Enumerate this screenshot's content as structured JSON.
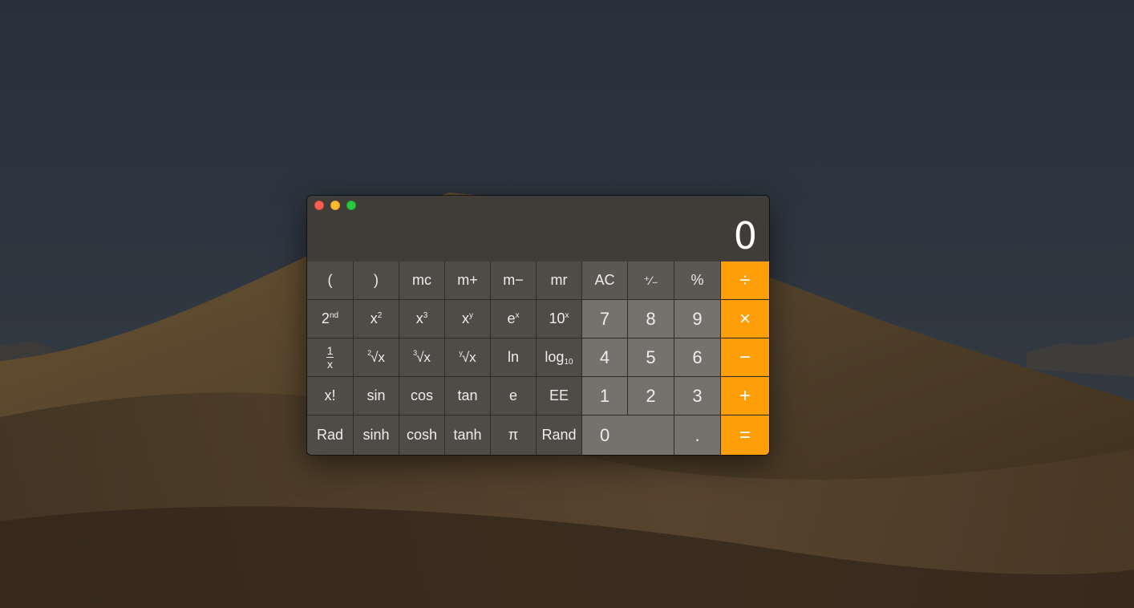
{
  "window": {
    "display_value": "0"
  },
  "colors": {
    "operator": "#fe9f0a",
    "number_key": "#75716d",
    "function_key": "#5b5753",
    "scientific_key": "#4f4b47",
    "close": "#fe5f57",
    "minimize": "#febc2e",
    "maximize": "#28c840"
  },
  "keys": {
    "open_paren": "(",
    "close_paren": ")",
    "mc": "mc",
    "m_plus": "m+",
    "m_minus": "m−",
    "mr": "mr",
    "ac": "AC",
    "plus_minus": "⁺∕₋",
    "percent": "%",
    "divide": "÷",
    "second_base": "2",
    "second_sup": "nd",
    "x_base": "x",
    "sq_sup": "2",
    "cube_sup": "3",
    "pow_sup": "y",
    "e_base": "e",
    "ex_sup": "x",
    "ten_base": "10",
    "tenx_sup": "x",
    "seven": "7",
    "eight": "8",
    "nine": "9",
    "multiply": "×",
    "recip_top": "1",
    "recip_bottom": "x",
    "sqrt_index": "2",
    "cbrt_index": "3",
    "yroot_index": "y",
    "root_x": "√x",
    "ln": "ln",
    "log_base": "log",
    "log_sub": "10",
    "four": "4",
    "five": "5",
    "six": "6",
    "minus": "−",
    "factorial": "x!",
    "sin": "sin",
    "cos": "cos",
    "tan": "tan",
    "e": "e",
    "ee": "EE",
    "one": "1",
    "two": "2",
    "three": "3",
    "plus": "+",
    "rad": "Rad",
    "sinh": "sinh",
    "cosh": "cosh",
    "tanh": "tanh",
    "pi": "π",
    "rand": "Rand",
    "zero": "0",
    "dot": ".",
    "equals": "="
  }
}
